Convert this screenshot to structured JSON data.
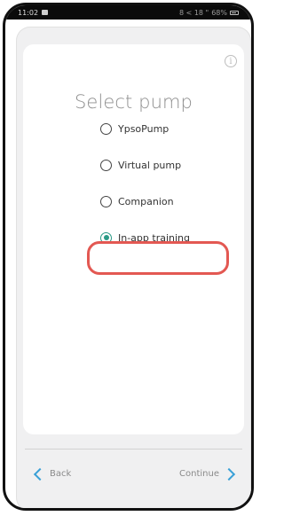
{
  "status_bar": {
    "time": "11:02",
    "right_text": "8 < 18 \"",
    "battery": "68%"
  },
  "page": {
    "title": "Select pump"
  },
  "options": [
    {
      "label": "YpsoPump",
      "selected": false
    },
    {
      "label": "Virtual pump",
      "selected": false
    },
    {
      "label": "Companion",
      "selected": false
    },
    {
      "label": "In-app training",
      "selected": true
    }
  ],
  "footer": {
    "back_label": "Back",
    "continue_label": "Continue"
  },
  "colors": {
    "accent_blue": "#39a0d7",
    "selected_green": "#2a9a86",
    "highlight_red": "#e35852"
  },
  "icons": {
    "info": "info-icon",
    "back": "chevron-left-icon",
    "continue": "chevron-right-icon"
  }
}
